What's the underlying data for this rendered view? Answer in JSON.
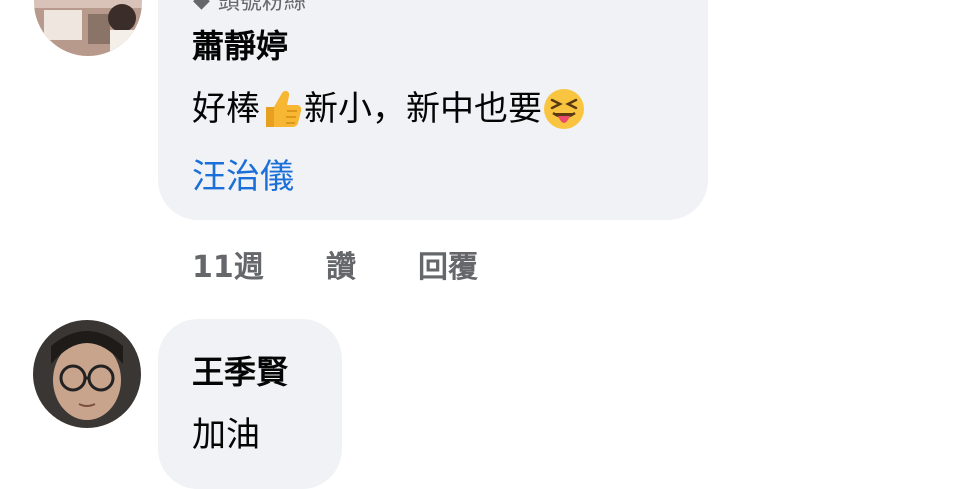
{
  "comment_1": {
    "badge": "頭號粉絲",
    "author": "蕭靜婷",
    "text_parts": [
      "好棒",
      "新小，新中也要"
    ],
    "emojis": [
      "thumbs-up-emoji",
      "squinting-tongue-emoji"
    ],
    "mention": "汪治儀",
    "time": "11週",
    "like_label": "讚",
    "reply_label": "回覆"
  },
  "comment_2": {
    "author": "王季賢",
    "text": "加油"
  },
  "colors": {
    "bubble": "#f0f2f5",
    "mention": "#1a6fd8",
    "meta": "#65676b",
    "text": "#050505"
  }
}
